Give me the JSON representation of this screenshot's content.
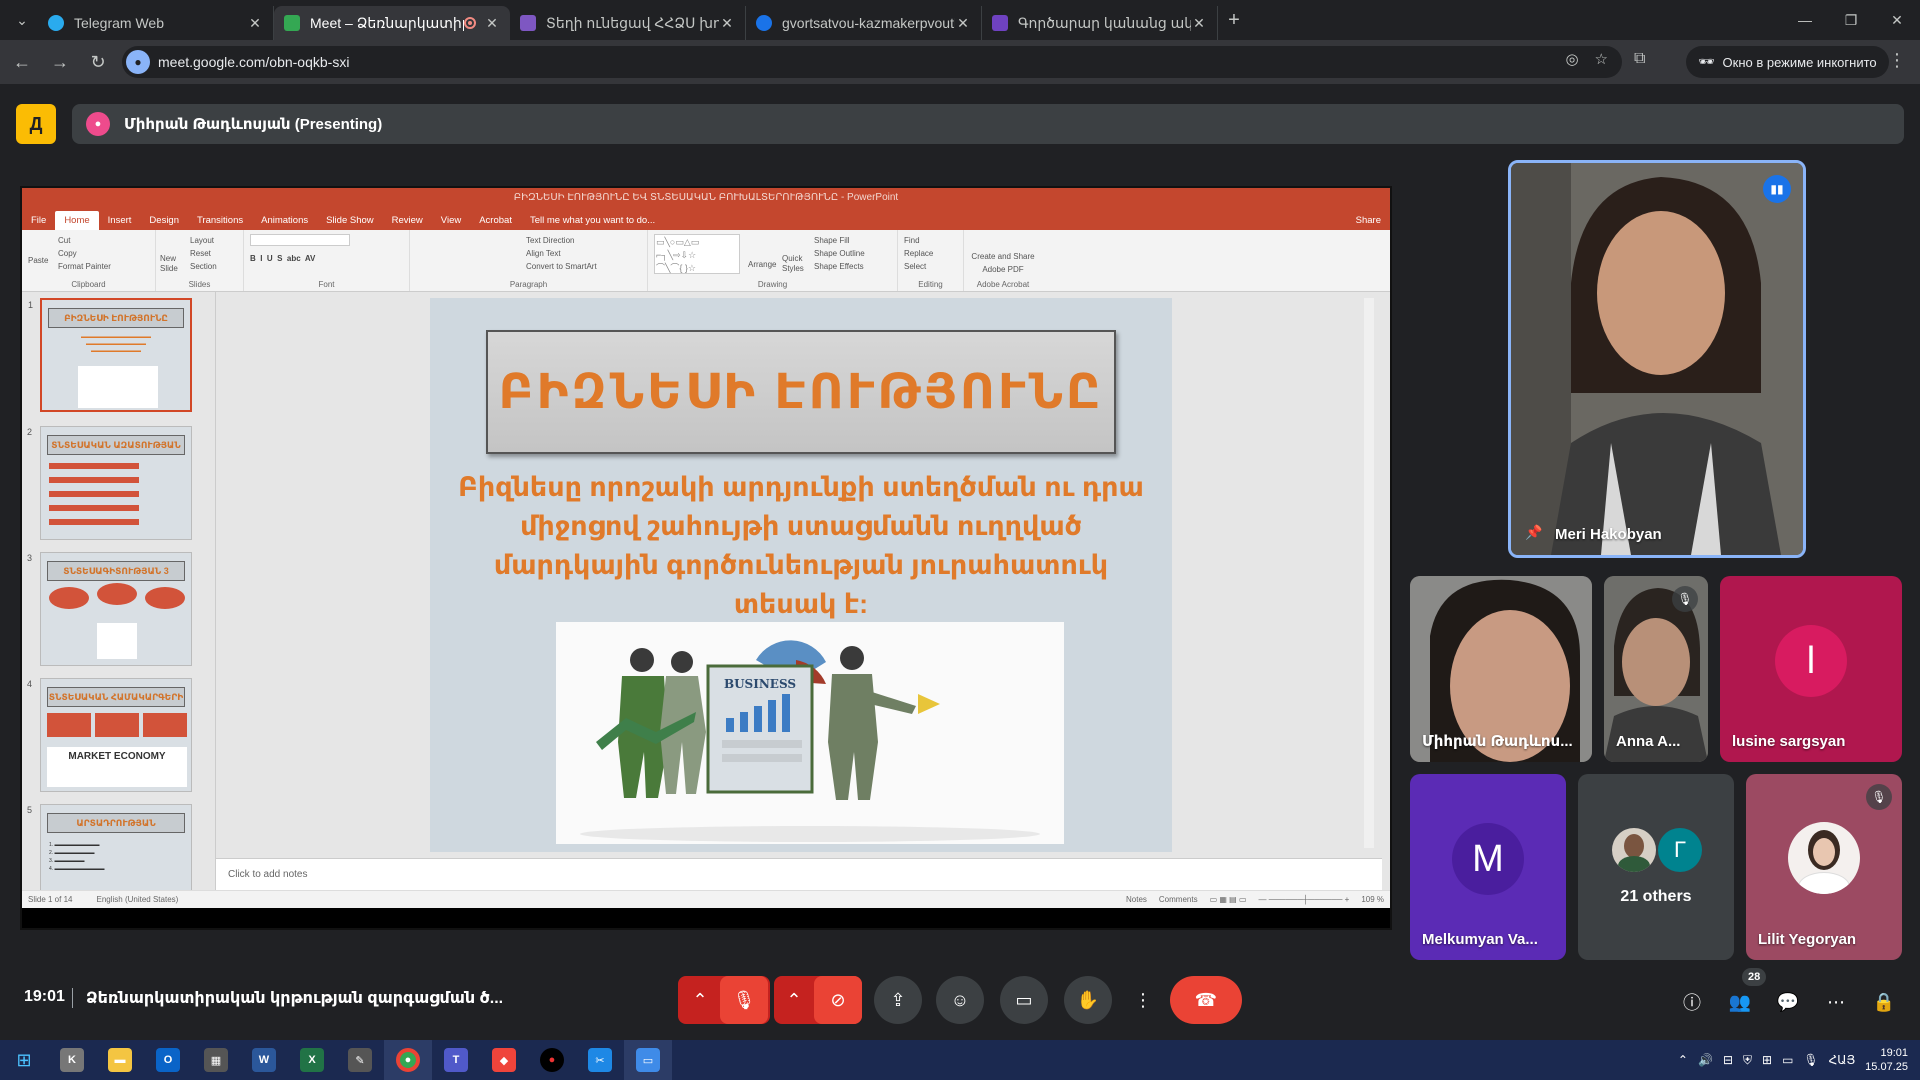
{
  "browser": {
    "tabs": [
      {
        "title": "Telegram Web",
        "fav": "#2aabee"
      },
      {
        "title": "Meet – Ձեռնարկատիրակ",
        "fav": "#34a853",
        "recording": true,
        "active": true
      },
      {
        "title": "Տեղի ունեցավ ՀՀՁՍ խորհրդ",
        "fav": "#7e57c2"
      },
      {
        "title": "gvortsatvou-kazmakerpvouthy",
        "fav": "#1a73e8"
      },
      {
        "title": "Գործարար կանանց ակումբ",
        "fav": "#6f42c1"
      }
    ],
    "url": "meet.google.com/obn-oqkb-sxi",
    "incognito_label": "Окно в режиме инкогнито"
  },
  "presenting": {
    "label": "Միհրան Թադևոսյան (Presenting)"
  },
  "powerpoint": {
    "window_title": "ԲԻԶՆԵՍԻ ԷՈՒԹՅՈՒՆԸ ԵՎ ՏՆՏԵՍԱԿԱՆ ԲՈՒԽԱԼՏԵՐՈՒԹՅՈՒՆԸ - PowerPoint",
    "menu": [
      "File",
      "Home",
      "Insert",
      "Design",
      "Transitions",
      "Animations",
      "Slide Show",
      "Review",
      "View",
      "Acrobat",
      "Tell me what you want to do..."
    ],
    "share": "Share",
    "ribbon": {
      "clipboard": {
        "label": "Clipboard",
        "items": [
          "Cut",
          "Copy",
          "Format Painter"
        ],
        "paste": "Paste"
      },
      "slides": {
        "label": "Slides",
        "new_slide": "New Slide",
        "items": [
          "Layout",
          "Reset",
          "Section"
        ]
      },
      "font": {
        "label": "Font"
      },
      "paragraph": {
        "label": "Paragraph",
        "items": [
          "Text Direction",
          "Align Text",
          "Convert to SmartArt"
        ]
      },
      "drawing": {
        "label": "Drawing",
        "arrange": "Arrange",
        "quick_styles": "Quick Styles",
        "items": [
          "Shape Fill",
          "Shape Outline",
          "Shape Effects"
        ]
      },
      "editing": {
        "label": "Editing",
        "items": [
          "Find",
          "Replace",
          "Select"
        ]
      },
      "acrobat": {
        "label": "Adobe Acrobat",
        "btn": "Create and Share Adobe PDF"
      }
    },
    "thumbnails": [
      {
        "num": "1",
        "title": "ԲԻԶՆԵՍԻ ԷՈՒԹՅՈՒՆԸ"
      },
      {
        "num": "2",
        "title": "ՏՆՏԵՍԱԿԱՆ ԱԶԱՏՈՒԹՅԱՆ ՏԵՍԱԿՆԵՐԸ"
      },
      {
        "num": "3",
        "title": "ՏՆՏԵՍԱԳԻՏՈՒԹՅԱՆ 3 ՀԻՄՆԱԿԱՆ ՀԱՐՑԵՐԸ"
      },
      {
        "num": "4",
        "title": "ՏՆՏԵՍԱԿԱՆ ՀԱՄԱԿԱՐԳԵՐԻ ՏԵՍԱԿՆԵՐԸ",
        "extra": "MARKET ECONOMY"
      },
      {
        "num": "5",
        "title": "ԱՐՏԱԴՐՈՒԹՅԱՆ ԳՈՐԾՈՆՆԵՐԸ"
      }
    ],
    "slide": {
      "title": "ԲԻԶՆԵՍԻ ԷՈՒԹՅՈՒՆԸ",
      "body": "Բիզնեսը որոշակի արդյունքի ստեղծման ու դրա միջոցով շահույթի ստացմանն ուղղված մարդկային գործունեության յուրահատուկ տեսակ է:",
      "image_text": "BUSINESS"
    },
    "notes_placeholder": "Click to add notes",
    "status": {
      "slide": "Slide 1 of 14",
      "lang": "English (United States)",
      "notes": "Notes",
      "comments": "Comments",
      "zoom": "109 %"
    }
  },
  "participants": {
    "pinned": {
      "name": "Meri Hakobyan"
    },
    "tiles": [
      {
        "name": "Միհրան Թադևոս...",
        "kind": "video"
      },
      {
        "name": "Anna A...",
        "kind": "video",
        "muted": true
      },
      {
        "name": "lusine sargsyan",
        "kind": "avatar",
        "initial": "l",
        "bg": "#b0174e",
        "circle": "#d81b60"
      },
      {
        "name": "Melkumyan Va...",
        "kind": "avatar",
        "initial": "M",
        "bg": "#5b2bb5",
        "circle": "#4a1e9e"
      },
      {
        "name": "21 others",
        "kind": "others",
        "initial": "Г"
      },
      {
        "name": "Lilit Yegoryan",
        "kind": "photo",
        "muted": true
      }
    ]
  },
  "bottombar": {
    "time": "19:01",
    "meeting_name": "Ձեռնարկատիրական կրթության զարգացման ծ...",
    "people_count": "28"
  },
  "taskbar": {
    "lang": "ՀԱՅ",
    "time": "19:01",
    "date": "15.07.25"
  }
}
